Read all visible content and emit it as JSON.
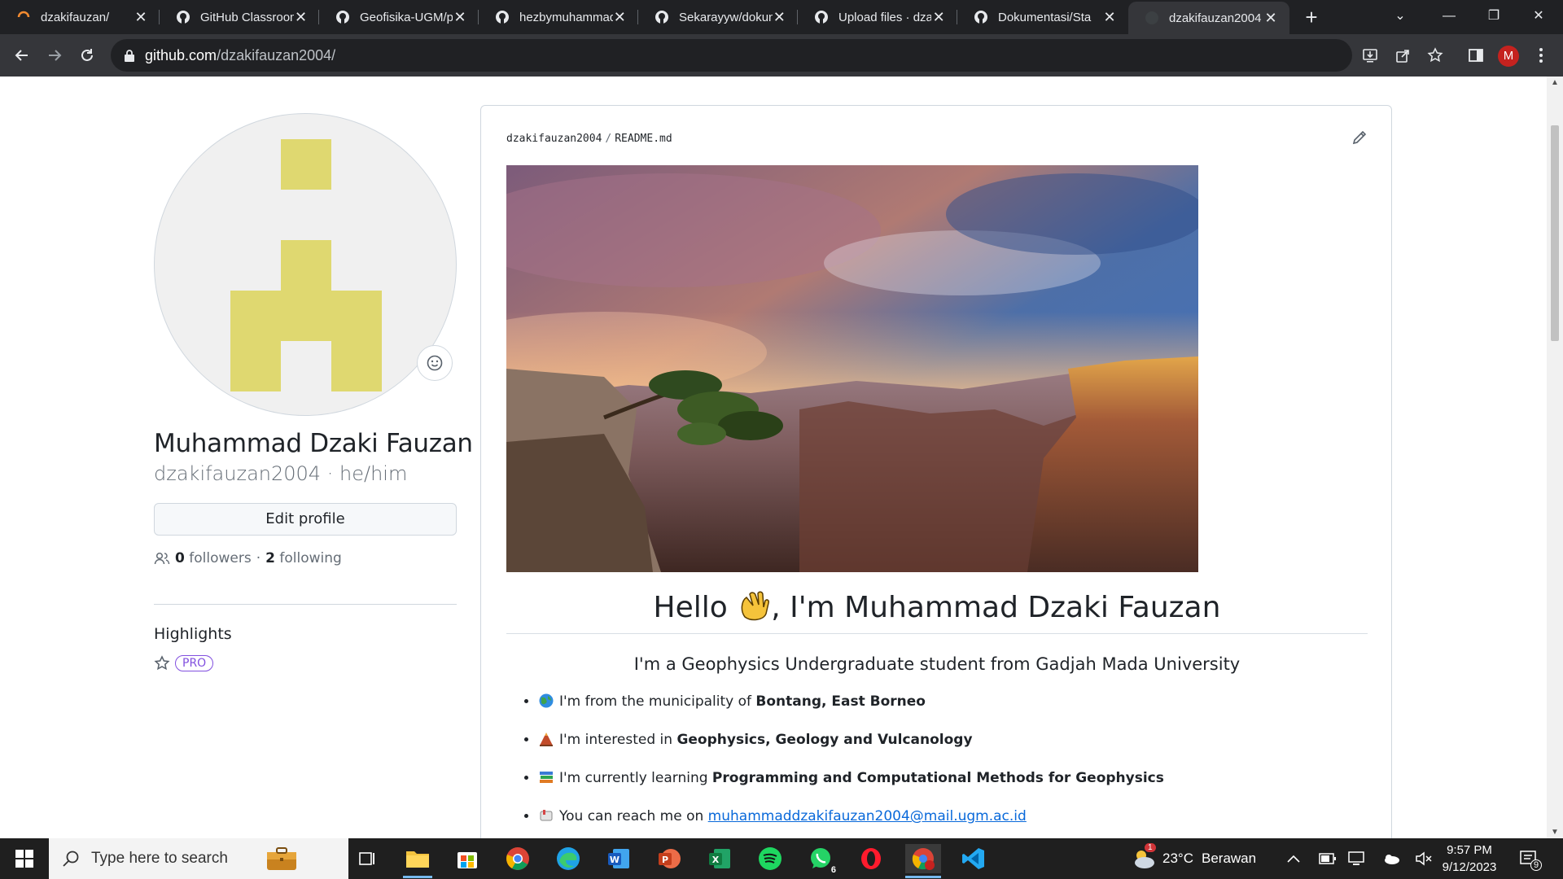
{
  "browser": {
    "tabs": [
      {
        "title": "dzakifauzan/",
        "favicon": "loading-spinner-icon"
      },
      {
        "title": "GitHub Classroom",
        "favicon": "github-icon"
      },
      {
        "title": "Geofisika-UGM/p",
        "favicon": "github-icon"
      },
      {
        "title": "hezbymuhammad",
        "favicon": "github-icon"
      },
      {
        "title": "Sekarayyw/dokun",
        "favicon": "github-icon"
      },
      {
        "title": "Upload files · dza",
        "favicon": "github-icon"
      },
      {
        "title": "Dokumentasi/Sta",
        "favicon": "github-icon"
      },
      {
        "title": "dzakifauzan2004",
        "favicon": "github-icon",
        "active": true
      }
    ],
    "url_host": "github.com",
    "url_path": "/dzakifauzan2004/",
    "profile_initial": "M"
  },
  "profile": {
    "full_name": "Muhammad Dzaki Fauzan",
    "username": "dzakifauzan2004",
    "separator": "·",
    "pronouns": "he/him",
    "edit_button": "Edit profile",
    "followers_count": "0",
    "followers_label": "followers",
    "dot": "·",
    "following_count": "2",
    "following_label": "following",
    "highlights_title": "Highlights",
    "pro_badge": "PRO"
  },
  "readme": {
    "owner": "dzakifauzan2004",
    "slash": "/",
    "file": "README.md",
    "hello_pre": "Hello ",
    "hello_post": ", I'm Muhammad Dzaki Fauzan",
    "subtitle": "I'm a Geophysics Undergraduate student from Gadjah Mada University",
    "bullets": [
      {
        "icon": "globe-icon",
        "text": "I'm from the municipality of ",
        "bold": "Bontang, East Borneo"
      },
      {
        "icon": "volcano-icon",
        "text": "I'm interested in ",
        "bold": "Geophysics, Geology and Vulcanology"
      },
      {
        "icon": "books-icon",
        "text": "I'm currently learning ",
        "bold": "Programming and Computational Methods for Geophysics"
      },
      {
        "icon": "mailbox-icon",
        "text": "You can reach me on ",
        "link": "muhammaddzakifauzan2004@mail.ugm.ac.id"
      }
    ]
  },
  "taskbar": {
    "search_placeholder": "Type here to search",
    "whatsapp_badge": "6",
    "weather_badge": "1",
    "temperature": "23°C",
    "weather": "Berawan",
    "time": "9:57 PM",
    "date": "9/12/2023",
    "notification_count": "9"
  },
  "colors": {
    "identicon": "#dfd870",
    "link": "#0969da",
    "pro": "#8250df"
  }
}
